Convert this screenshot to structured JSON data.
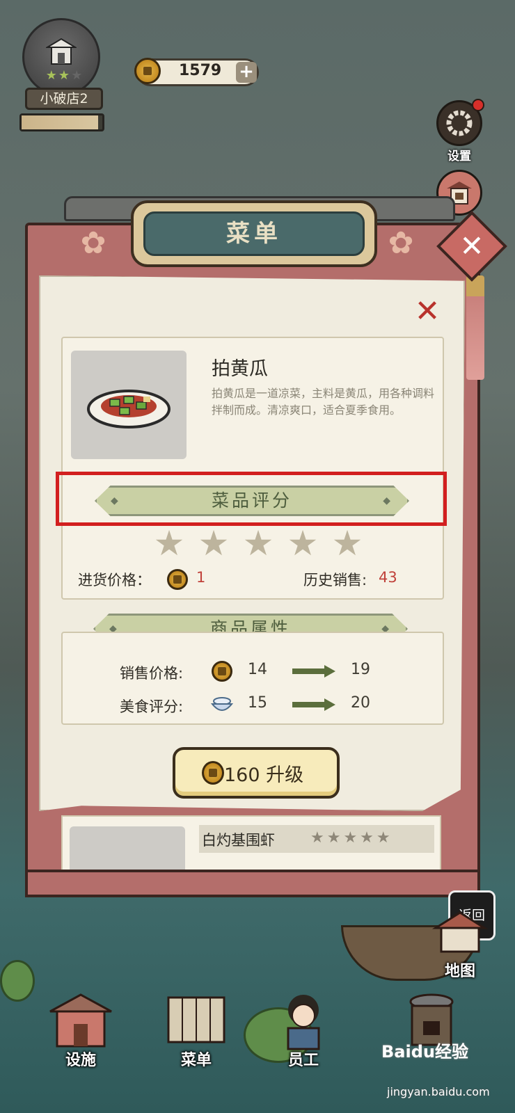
{
  "shop": {
    "name": "小破店2",
    "stars": "★★",
    "level_progress": 0.95
  },
  "currency": {
    "coins": "1579",
    "plus_label": "+"
  },
  "side_buttons": {
    "settings": "设置",
    "shop_partial": "商店"
  },
  "menu": {
    "title": "菜单",
    "close_icon": "✕",
    "dish": {
      "name": "拍黄瓜",
      "description": "拍黄瓜是一道凉菜，主料是黄瓜，用各种调料拌制而成。清凉爽口，适合夏季食用。",
      "rating_title": "菜品评分",
      "rating_stars": 0,
      "purchase_price_label": "进货价格：",
      "purchase_price_value": "1",
      "history_sales_label": "历史销售:",
      "history_sales_value": "43"
    },
    "attributes": {
      "title": "商品属性",
      "sale_price_label": "销售价格:",
      "sale_price_from": "14",
      "sale_price_to": "19",
      "food_rating_label": "美食评分:",
      "food_rating_from": "15",
      "food_rating_to": "20"
    },
    "upgrade": {
      "cost": "160",
      "label": "升级"
    },
    "next_dish": {
      "name": "白灼基围虾",
      "stars": "★★★★★"
    }
  },
  "nav": {
    "facilities": "设施",
    "menu": "菜单",
    "staff": "员工",
    "map": "地图"
  },
  "back_button": "返回",
  "watermark": {
    "brand": "Baidu经验",
    "url": "jingyan.baidu.com"
  },
  "colors": {
    "highlight": "#d21f1f",
    "accent_red": "#c0413a",
    "ribbon_green": "#c9d0a4"
  }
}
